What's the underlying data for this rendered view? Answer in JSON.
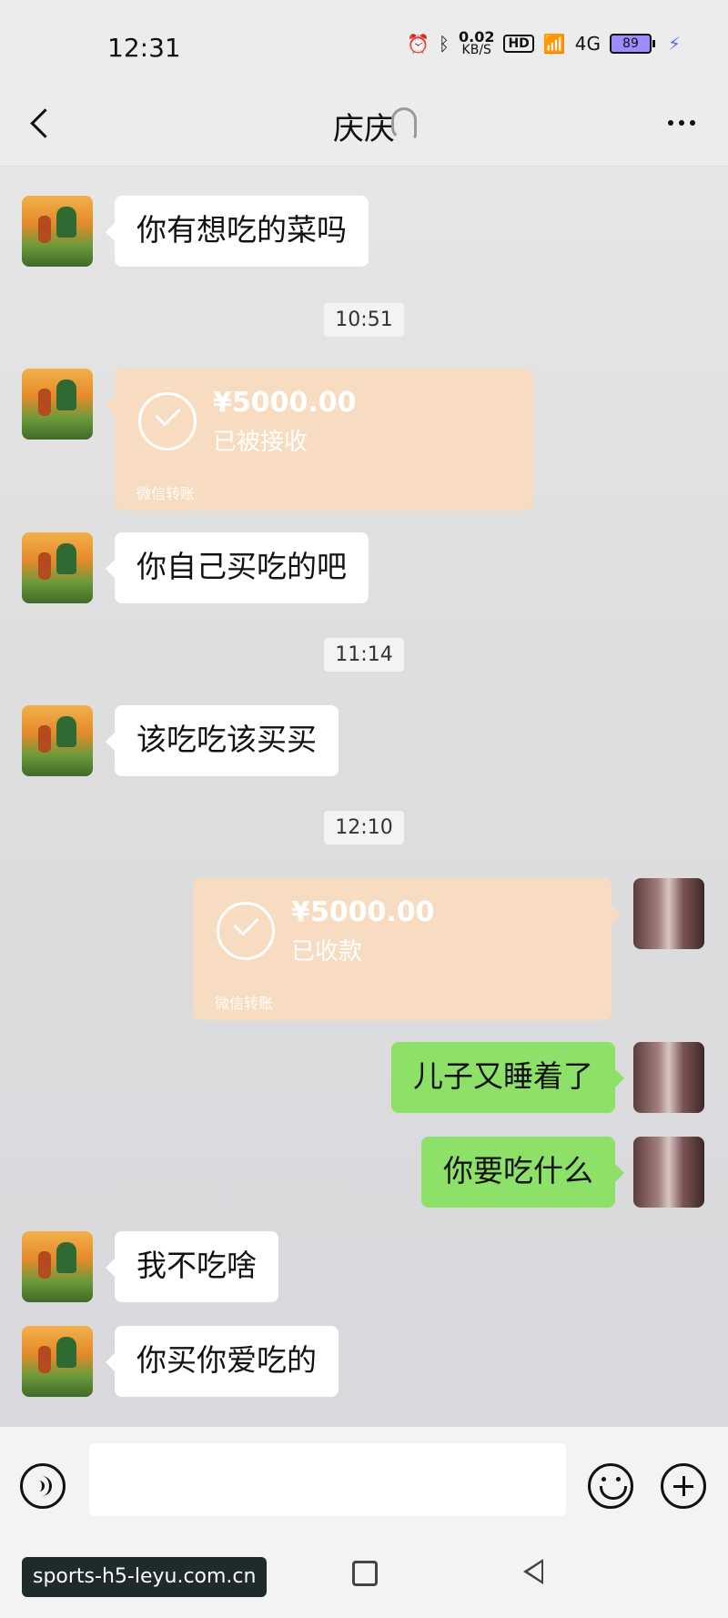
{
  "status_bar": {
    "time": "12:31",
    "net_speed_value": "0.02",
    "net_speed_unit": "KB/S",
    "hd": "HD",
    "network_type": "4G",
    "battery": "89",
    "colors": {
      "battery_fill": "#9b8cff",
      "bolt": "#5a6bff"
    }
  },
  "header": {
    "title": "庆庆",
    "back_icon": "chevron-left-icon",
    "ear_icon": "ear-icon",
    "more_icon": "ellipsis-icon"
  },
  "messages": [
    {
      "side": "left",
      "type": "text",
      "text": "你有想吃的菜吗"
    },
    {
      "type": "time",
      "text": "10:51"
    },
    {
      "side": "left",
      "type": "transfer",
      "amount": "¥5000.00",
      "status": "已被接收",
      "footer": "微信转账"
    },
    {
      "side": "left",
      "type": "text",
      "text": "你自己买吃的吧"
    },
    {
      "type": "time",
      "text": "11:14"
    },
    {
      "side": "left",
      "type": "text",
      "text": "该吃吃该买买"
    },
    {
      "type": "time",
      "text": "12:10"
    },
    {
      "side": "right",
      "type": "transfer",
      "amount": "¥5000.00",
      "status": "已收款",
      "footer": "微信转账"
    },
    {
      "side": "right",
      "type": "text",
      "text": "儿子又睡着了"
    },
    {
      "side": "right",
      "type": "text",
      "text": "你要吃什么"
    },
    {
      "side": "left",
      "type": "text",
      "text": "我不吃啥"
    },
    {
      "side": "left",
      "type": "text",
      "text": "你买你爱吃的"
    }
  ],
  "input_bar": {
    "voice_icon": "voice-icon",
    "emoji_icon": "emoji-icon",
    "plus_icon": "plus-icon",
    "input_value": ""
  },
  "watermark": "sports-h5-leyu.com.cn",
  "colors": {
    "left_bubble": "#ffffff",
    "right_bubble": "#8de168",
    "transfer": "#f8dcc1"
  }
}
